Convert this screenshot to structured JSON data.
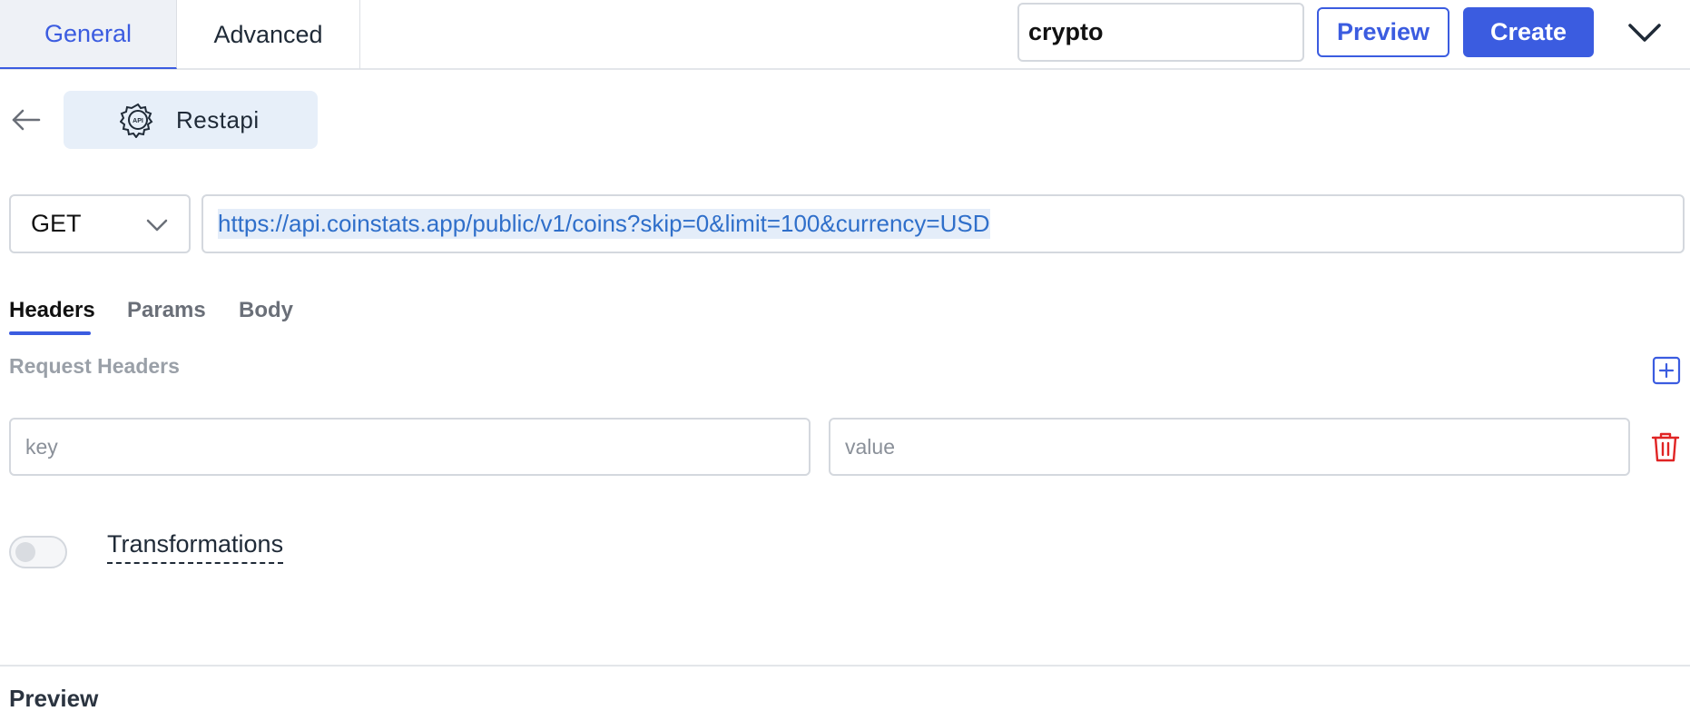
{
  "tabs": {
    "general": "General",
    "advanced": "Advanced"
  },
  "header": {
    "query_name_value": "crypto",
    "preview_label": "Preview",
    "create_label": "Create",
    "accent_color": "#3b5ce0"
  },
  "source": {
    "label": "Restapi",
    "icon": "api-gear-icon"
  },
  "request": {
    "method": "GET",
    "url": "https://api.coinstats.app/public/v1/coins?skip=0&limit=100&currency=USD"
  },
  "subtabs": {
    "headers": "Headers",
    "params": "Params",
    "body": "Body",
    "active": "Headers"
  },
  "headers_section": {
    "title": "Request Headers",
    "key_placeholder": "key",
    "value_placeholder": "value",
    "delete_color": "#e02424"
  },
  "transformations": {
    "label": "Transformations",
    "enabled": false
  },
  "preview": {
    "title": "Preview"
  }
}
